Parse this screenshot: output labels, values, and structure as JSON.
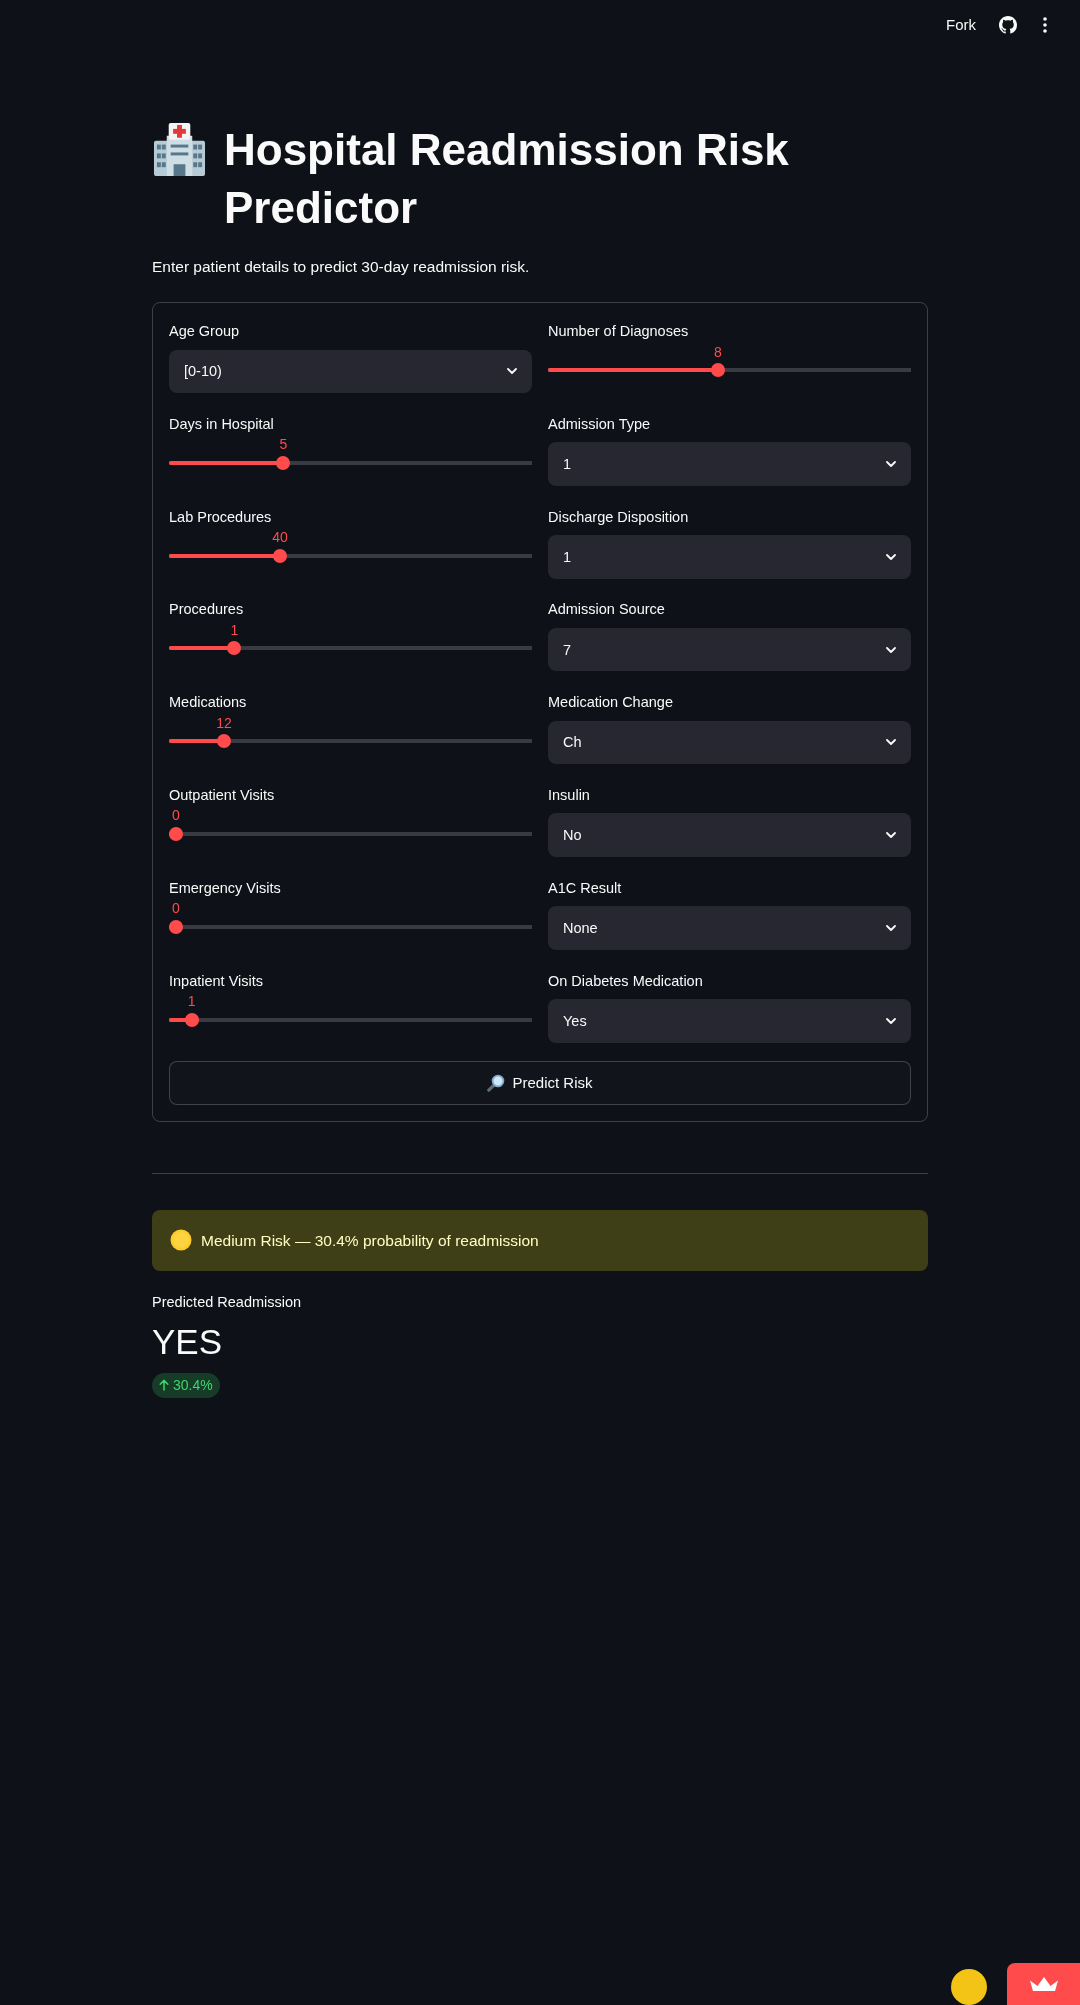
{
  "header": {
    "fork_label": "Fork"
  },
  "title": "Hospital Readmission Risk Predictor",
  "subtitle": "Enter patient details to predict 30-day readmission risk.",
  "form": {
    "left_column": [
      {
        "kind": "select",
        "label": "Age Group",
        "value": "[0-10)"
      },
      {
        "kind": "slider",
        "label": "Days in Hospital",
        "reading": "5",
        "level": 0.308
      },
      {
        "kind": "slider",
        "label": "Lab Procedures",
        "reading": "40",
        "level": 0.298
      },
      {
        "kind": "slider",
        "label": "Procedures",
        "reading": "1",
        "level": 0.167
      },
      {
        "kind": "slider",
        "label": "Medications",
        "reading": "12",
        "level": 0.1375
      },
      {
        "kind": "slider",
        "label": "Outpatient Visits",
        "reading": "0",
        "level": 0
      },
      {
        "kind": "slider",
        "label": "Emergency Visits",
        "reading": "0",
        "level": 0
      },
      {
        "kind": "slider",
        "label": "Inpatient Visits",
        "reading": "1",
        "level": 0.045
      }
    ],
    "right_column": [
      {
        "kind": "slider",
        "label": "Number of Diagnoses",
        "reading": "8",
        "level": 0.467
      },
      {
        "kind": "select",
        "label": "Admission Type",
        "value": "1"
      },
      {
        "kind": "select",
        "label": "Discharge Disposition",
        "value": "1"
      },
      {
        "kind": "select",
        "label": "Admission Source",
        "value": "7"
      },
      {
        "kind": "select",
        "label": "Medication Change",
        "value": "Ch"
      },
      {
        "kind": "select",
        "label": "Insulin",
        "value": "No"
      },
      {
        "kind": "select",
        "label": "A1C Result",
        "value": "None"
      },
      {
        "kind": "select",
        "label": "On Diabetes Medication",
        "value": "Yes"
      }
    ],
    "submit_button": "Predict Risk"
  },
  "result": {
    "alert": "Medium Risk — 30.4% probability of readmission",
    "metric": {
      "label": "Predicted Readmission",
      "value": "YES",
      "delta": "30.4%"
    }
  }
}
